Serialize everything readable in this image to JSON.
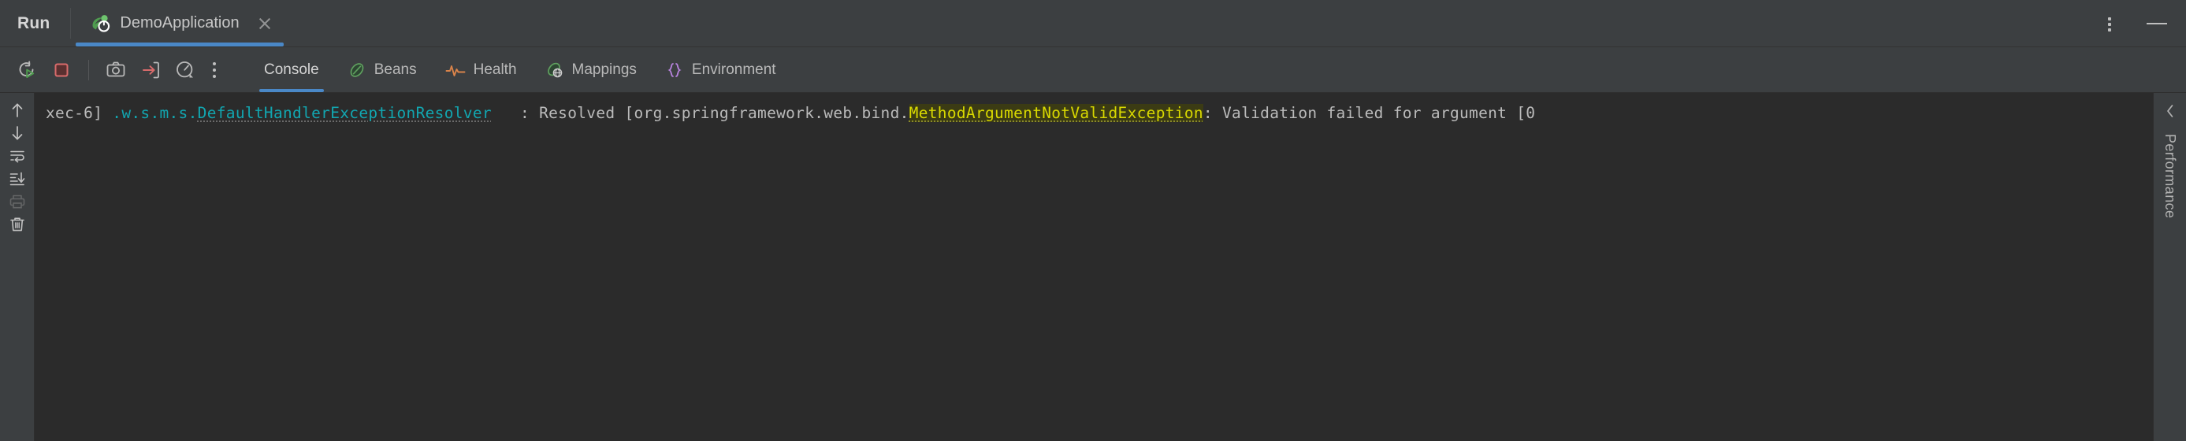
{
  "window": {
    "run_label": "Run",
    "tab": {
      "title": "DemoApplication",
      "icon": "springboot-leaf-run-icon",
      "close_icon": "close-icon",
      "active_underline_color": "#4a88c7"
    },
    "kebab_icon": "more-vertical-icon",
    "minimize_icon": "minimize-icon"
  },
  "toolbar": {
    "buttons": [
      {
        "name": "rerun-button",
        "icon": "rerun-icon",
        "tooltip": "Rerun",
        "enabled": true
      },
      {
        "name": "stop-button",
        "icon": "stop-square-icon",
        "tooltip": "Stop",
        "enabled": true
      },
      {
        "name": "camera-button",
        "icon": "camera-icon",
        "tooltip": "Snapshot",
        "enabled": true
      },
      {
        "name": "open-in-browser-button",
        "icon": "arrow-into-box-icon",
        "tooltip": "Open in Browser",
        "enabled": true
      },
      {
        "name": "actuator-button",
        "icon": "gauge-icon",
        "tooltip": "Actuator",
        "enabled": true
      },
      {
        "name": "more-options-button",
        "icon": "more-vertical-icon",
        "tooltip": "More",
        "enabled": true
      }
    ]
  },
  "view_tabs": [
    {
      "label": "Console",
      "icon": "console-icon",
      "active": true
    },
    {
      "label": "Beans",
      "icon": "beans-leaf-icon",
      "active": false
    },
    {
      "label": "Health",
      "icon": "heartbeat-icon",
      "active": false
    },
    {
      "label": "Mappings",
      "icon": "mappings-globe-leaf-icon",
      "active": false
    },
    {
      "label": "Environment",
      "icon": "braces-icon",
      "active": false
    }
  ],
  "gutter_buttons": [
    {
      "name": "up-arrow-button",
      "icon": "arrow-up-icon",
      "enabled": true
    },
    {
      "name": "down-arrow-button",
      "icon": "arrow-down-icon",
      "enabled": true
    },
    {
      "name": "soft-wrap-button",
      "icon": "soft-wrap-icon",
      "enabled": true
    },
    {
      "name": "scroll-to-end-button",
      "icon": "scroll-to-end-icon",
      "enabled": true
    },
    {
      "name": "print-button",
      "icon": "printer-icon",
      "enabled": false
    },
    {
      "name": "clear-all-button",
      "icon": "trash-icon",
      "enabled": true
    }
  ],
  "console": {
    "line": {
      "prefix": "xec-6] ",
      "logger_dots": ".w.s.m.s.",
      "logger": "DefaultHandlerExceptionResolver",
      "separator": "   : Resolved [org.springframework.web.bind.",
      "exception": "MethodArgumentNotValidException",
      "message": ": Validation failed for argument [0"
    },
    "colors": {
      "background": "#2b2b2b",
      "text": "#bbbbbb",
      "logger": "#12a6b0",
      "exception_text": "#d9d900",
      "exception_highlight": "#3b3b14"
    }
  },
  "right_rail": {
    "collapse_icon": "chevron-left-icon",
    "label": "Performance"
  }
}
